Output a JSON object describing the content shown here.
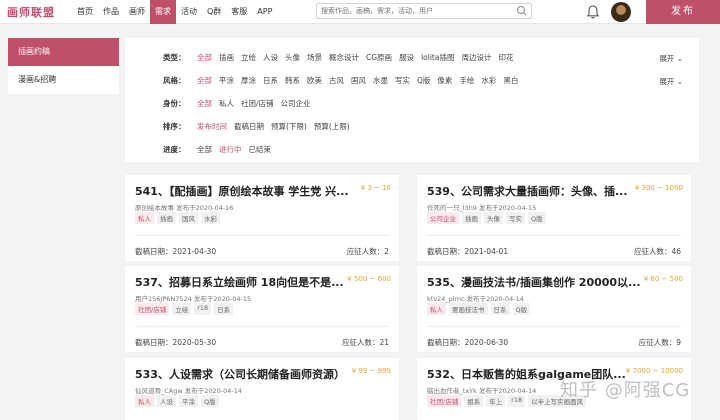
{
  "header": {
    "logo": "画师联盟",
    "nav": [
      "首页",
      "作品",
      "画师",
      "需求",
      "活动",
      "Q群",
      "客服",
      "APP"
    ],
    "active_nav": "需求",
    "search_placeholder": "搜索作品，画稿，需求，活动，用户",
    "publish_label": "发布"
  },
  "sidebar": {
    "items": [
      {
        "label": "插画约稿",
        "active": true
      },
      {
        "label": "漫画&招聘",
        "active": false
      }
    ]
  },
  "filters": [
    {
      "label": "类型：",
      "options": [
        "全部",
        "插画",
        "立绘",
        "人设",
        "头像",
        "场景",
        "概念设计",
        "CG原画",
        "服设",
        "lolita插图",
        "周边设计",
        "印花"
      ],
      "selected": "全部",
      "expand": "展开"
    },
    {
      "label": "风格：",
      "options": [
        "全部",
        "平涂",
        "厚涂",
        "日系",
        "韩系",
        "欧美",
        "古风",
        "国风",
        "水墨",
        "写实",
        "Q版",
        "像素",
        "手绘",
        "水彩",
        "黑白"
      ],
      "selected": "全部",
      "expand": "展开"
    },
    {
      "label": "身份：",
      "options": [
        "全部",
        "私人",
        "社团/店铺",
        "公司企业"
      ],
      "selected": "全部",
      "expand": ""
    },
    {
      "label": "排序：",
      "options": [
        "发布时间",
        "截稿日期",
        "预算(下限)",
        "预算(上限)"
      ],
      "selected": "发布时间",
      "expand": ""
    },
    {
      "label": "进度：",
      "options": [
        "全部",
        "进行中",
        "已结束"
      ],
      "selected": "进行中",
      "expand": ""
    }
  ],
  "cards": [
    {
      "title": "541、【配插画】原创绘本故事 学生党 兴...",
      "price": "¥ 3 ~ 10",
      "meta": "原创绘本故事 发布于2020-04-16",
      "tags": [
        "私人",
        "插画",
        "国风",
        "水彩"
      ],
      "deadline": "截稿日期：2021-04-30",
      "applicants": "应征人数：2"
    },
    {
      "title": "539、公司需求大量插画师：头像、插...",
      "price": "¥ 300 ~ 1000",
      "meta": "作死的一只_l3h9 发布于2020-04-15",
      "tags": [
        "公司企业",
        "插画",
        "头像",
        "写实",
        "Q版"
      ],
      "deadline": "截稿日期：2021-04-01",
      "applicants": "应征人数：46"
    },
    {
      "title": "537、招募日系立绘画师 18向但是不是...",
      "price": "¥ 500 ~ 600",
      "meta": "用户156JP6N7524 发布于2020-04-15",
      "tags": [
        "社团/店铺",
        "立绘",
        "r18",
        "日系"
      ],
      "deadline": "截稿日期：2020-05-30",
      "applicants": "应征人数：21"
    },
    {
      "title": "535、漫画技法书/插画集创作 20000以...",
      "price": "¥ 60 ~ 500",
      "meta": "ktv24_plmc 发布于2020-04-14",
      "tags": [
        "私人",
        "要画技法书",
        "日系",
        "Q版"
      ],
      "deadline": "截稿日期：2020-06-30",
      "applicants": "应征人数：9"
    },
    {
      "title": "533、人设需求（公司长期储备画师资源）",
      "price": "¥ 99 ~ 999",
      "meta": "仙风道骨_CAgw 发布于2020-04-14",
      "tags": [
        "私人",
        "人设",
        "平涂",
        "Q版"
      ],
      "deadline": "",
      "applicants": ""
    },
    {
      "title": "532、日本贩售的姐系galgame团队...",
      "price": "¥ 7000 ~ 10000",
      "meta": "脑出血作者_txYk 发布于2020-04-14",
      "tags": [
        "社团/店铺",
        "姐系",
        "年上",
        "r18",
        "以半上写实画面风"
      ],
      "deadline": "",
      "applicants": ""
    }
  ],
  "watermark": "知乎 @阿强CG",
  "colors": {
    "accent": "#c0506a",
    "price": "#e8a33a"
  }
}
